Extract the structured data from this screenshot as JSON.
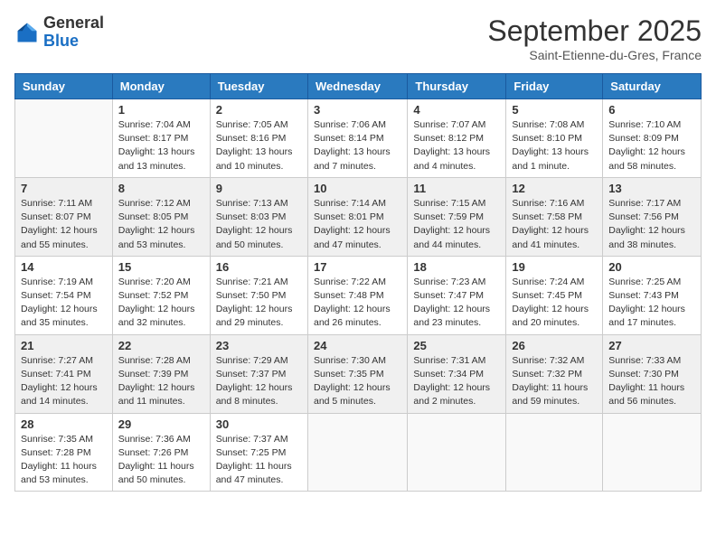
{
  "logo": {
    "general": "General",
    "blue": "Blue"
  },
  "header": {
    "month": "September 2025",
    "location": "Saint-Etienne-du-Gres, France"
  },
  "weekdays": [
    "Sunday",
    "Monday",
    "Tuesday",
    "Wednesday",
    "Thursday",
    "Friday",
    "Saturday"
  ],
  "weeks": [
    [
      {
        "day": "",
        "info": ""
      },
      {
        "day": "1",
        "info": "Sunrise: 7:04 AM\nSunset: 8:17 PM\nDaylight: 13 hours\nand 13 minutes."
      },
      {
        "day": "2",
        "info": "Sunrise: 7:05 AM\nSunset: 8:16 PM\nDaylight: 13 hours\nand 10 minutes."
      },
      {
        "day": "3",
        "info": "Sunrise: 7:06 AM\nSunset: 8:14 PM\nDaylight: 13 hours\nand 7 minutes."
      },
      {
        "day": "4",
        "info": "Sunrise: 7:07 AM\nSunset: 8:12 PM\nDaylight: 13 hours\nand 4 minutes."
      },
      {
        "day": "5",
        "info": "Sunrise: 7:08 AM\nSunset: 8:10 PM\nDaylight: 13 hours\nand 1 minute."
      },
      {
        "day": "6",
        "info": "Sunrise: 7:10 AM\nSunset: 8:09 PM\nDaylight: 12 hours\nand 58 minutes."
      }
    ],
    [
      {
        "day": "7",
        "info": "Sunrise: 7:11 AM\nSunset: 8:07 PM\nDaylight: 12 hours\nand 55 minutes."
      },
      {
        "day": "8",
        "info": "Sunrise: 7:12 AM\nSunset: 8:05 PM\nDaylight: 12 hours\nand 53 minutes."
      },
      {
        "day": "9",
        "info": "Sunrise: 7:13 AM\nSunset: 8:03 PM\nDaylight: 12 hours\nand 50 minutes."
      },
      {
        "day": "10",
        "info": "Sunrise: 7:14 AM\nSunset: 8:01 PM\nDaylight: 12 hours\nand 47 minutes."
      },
      {
        "day": "11",
        "info": "Sunrise: 7:15 AM\nSunset: 7:59 PM\nDaylight: 12 hours\nand 44 minutes."
      },
      {
        "day": "12",
        "info": "Sunrise: 7:16 AM\nSunset: 7:58 PM\nDaylight: 12 hours\nand 41 minutes."
      },
      {
        "day": "13",
        "info": "Sunrise: 7:17 AM\nSunset: 7:56 PM\nDaylight: 12 hours\nand 38 minutes."
      }
    ],
    [
      {
        "day": "14",
        "info": "Sunrise: 7:19 AM\nSunset: 7:54 PM\nDaylight: 12 hours\nand 35 minutes."
      },
      {
        "day": "15",
        "info": "Sunrise: 7:20 AM\nSunset: 7:52 PM\nDaylight: 12 hours\nand 32 minutes."
      },
      {
        "day": "16",
        "info": "Sunrise: 7:21 AM\nSunset: 7:50 PM\nDaylight: 12 hours\nand 29 minutes."
      },
      {
        "day": "17",
        "info": "Sunrise: 7:22 AM\nSunset: 7:48 PM\nDaylight: 12 hours\nand 26 minutes."
      },
      {
        "day": "18",
        "info": "Sunrise: 7:23 AM\nSunset: 7:47 PM\nDaylight: 12 hours\nand 23 minutes."
      },
      {
        "day": "19",
        "info": "Sunrise: 7:24 AM\nSunset: 7:45 PM\nDaylight: 12 hours\nand 20 minutes."
      },
      {
        "day": "20",
        "info": "Sunrise: 7:25 AM\nSunset: 7:43 PM\nDaylight: 12 hours\nand 17 minutes."
      }
    ],
    [
      {
        "day": "21",
        "info": "Sunrise: 7:27 AM\nSunset: 7:41 PM\nDaylight: 12 hours\nand 14 minutes."
      },
      {
        "day": "22",
        "info": "Sunrise: 7:28 AM\nSunset: 7:39 PM\nDaylight: 12 hours\nand 11 minutes."
      },
      {
        "day": "23",
        "info": "Sunrise: 7:29 AM\nSunset: 7:37 PM\nDaylight: 12 hours\nand 8 minutes."
      },
      {
        "day": "24",
        "info": "Sunrise: 7:30 AM\nSunset: 7:35 PM\nDaylight: 12 hours\nand 5 minutes."
      },
      {
        "day": "25",
        "info": "Sunrise: 7:31 AM\nSunset: 7:34 PM\nDaylight: 12 hours\nand 2 minutes."
      },
      {
        "day": "26",
        "info": "Sunrise: 7:32 AM\nSunset: 7:32 PM\nDaylight: 11 hours\nand 59 minutes."
      },
      {
        "day": "27",
        "info": "Sunrise: 7:33 AM\nSunset: 7:30 PM\nDaylight: 11 hours\nand 56 minutes."
      }
    ],
    [
      {
        "day": "28",
        "info": "Sunrise: 7:35 AM\nSunset: 7:28 PM\nDaylight: 11 hours\nand 53 minutes."
      },
      {
        "day": "29",
        "info": "Sunrise: 7:36 AM\nSunset: 7:26 PM\nDaylight: 11 hours\nand 50 minutes."
      },
      {
        "day": "30",
        "info": "Sunrise: 7:37 AM\nSunset: 7:25 PM\nDaylight: 11 hours\nand 47 minutes."
      },
      {
        "day": "",
        "info": ""
      },
      {
        "day": "",
        "info": ""
      },
      {
        "day": "",
        "info": ""
      },
      {
        "day": "",
        "info": ""
      }
    ]
  ]
}
